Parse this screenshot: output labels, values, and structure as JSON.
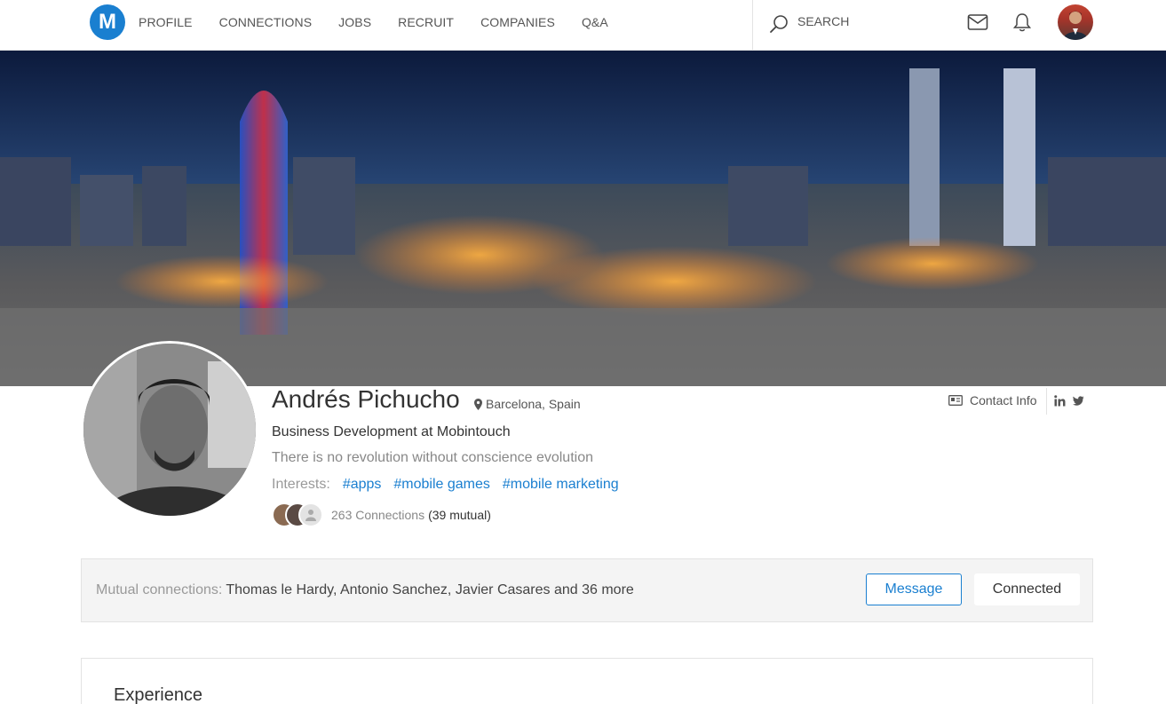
{
  "nav": {
    "logo_letter": "M",
    "links": [
      "PROFILE",
      "CONNECTIONS",
      "JOBS",
      "RECRUIT",
      "COMPANIES",
      "Q&A"
    ],
    "search_placeholder": "SEARCH",
    "icons": [
      "search-icon",
      "mail-icon",
      "bell-icon"
    ]
  },
  "profile": {
    "name": "Andrés Pichucho",
    "location": "Barcelona, Spain",
    "headline": "Business Development at Mobintouch",
    "tagline": "There is no revolution without conscience evolution",
    "interests_label": "Interests:",
    "interests": [
      "#apps",
      "#mobile games",
      "#mobile marketing"
    ],
    "connections_text": "263 Connections",
    "mutual_text": "(39 mutual)",
    "contact_info": "Contact Info",
    "social": [
      "linkedin-icon",
      "twitter-icon"
    ]
  },
  "mutual": {
    "label": "Mutual connections:",
    "names": "Thomas le Hardy, Antonio Sanchez, Javier Casares and 36 more",
    "message_button": "Message",
    "connected_button": "Connected"
  },
  "experience": {
    "title": "Experience"
  },
  "colors": {
    "accent": "#1a7fd0",
    "muted_text": "#999999",
    "bar_bg": "#f4f4f4"
  }
}
